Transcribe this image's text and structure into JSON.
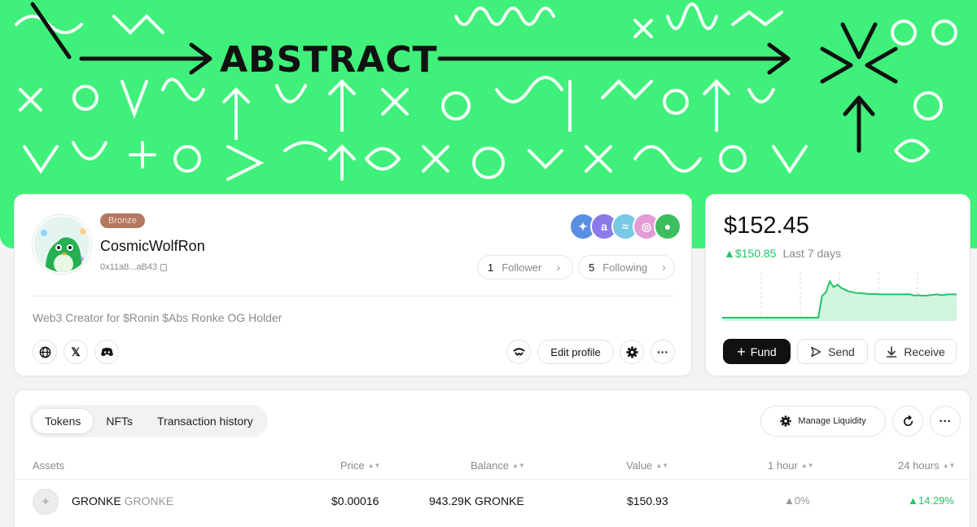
{
  "banner": {
    "title": "ABSTRACT",
    "bg_color": "#3ff07a"
  },
  "profile": {
    "tier_badge": "Bronze",
    "username": "CosmicWolfRon",
    "address": "0x11a8...aB43",
    "bio": "Web3 Creator for $Ronin $Abs Ronke OG Holder",
    "followers": {
      "count": "1",
      "label": "Follower"
    },
    "following": {
      "count": "5",
      "label": "Following"
    },
    "social_icons": [
      "globe-icon",
      "x-icon",
      "discord-icon"
    ],
    "edit_label": "Edit profile"
  },
  "balance": {
    "amount": "$152.45",
    "change": "▲$150.85",
    "period": "Last 7 days",
    "accent": "#26c267",
    "chart_data": {
      "type": "area",
      "values": [
        0,
        0,
        0,
        0,
        0,
        0,
        0,
        0,
        0,
        0,
        0,
        0,
        0,
        0,
        0,
        0,
        0,
        0,
        0,
        0,
        0,
        0,
        0,
        0,
        0,
        0,
        0.52,
        0.6,
        0.86,
        0.72,
        0.78,
        0.7,
        0.66,
        0.62,
        0.6,
        0.58,
        0.58,
        0.57,
        0.56,
        0.56,
        0.56,
        0.55,
        0.55,
        0.55,
        0.55,
        0.55,
        0.55,
        0.55,
        0.55,
        0.55,
        0.52,
        0.53,
        0.52,
        0.52,
        0.53,
        0.54,
        0.55,
        0.53,
        0.54,
        0.55,
        0.55,
        0.55
      ]
    },
    "fund_label": "Fund",
    "send_label": "Send",
    "receive_label": "Receive"
  },
  "assets": {
    "tabs": [
      "Tokens",
      "NFTs",
      "Transaction history"
    ],
    "active_tab": "Tokens",
    "manage_label": "Manage Liquidity",
    "columns": [
      "Assets",
      "Price",
      "Balance",
      "Value",
      "1 hour",
      "24 hours"
    ],
    "rows": [
      {
        "name": "GRONKE",
        "ticker": "GRONKE",
        "price": "$0.00016",
        "balance": "943.29K GRONKE",
        "value": "$150.93",
        "h1": "▲0%",
        "h24": "▲14.29%"
      }
    ]
  }
}
